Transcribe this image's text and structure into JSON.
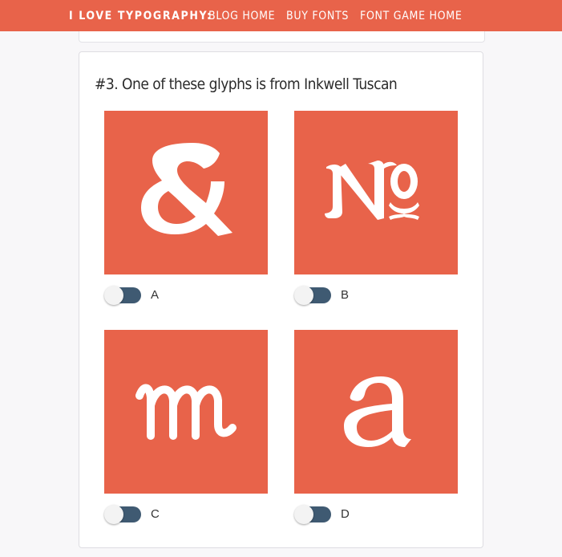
{
  "nav": {
    "brand": "I LOVE TYPOGRAPHY:",
    "links": [
      "BLOG HOME",
      "BUY FONTS",
      "FONT GAME HOME"
    ]
  },
  "question": {
    "text": "#3. One of these glyphs is from Inkwell Tuscan"
  },
  "options": [
    {
      "label": "A",
      "glyph": "ampersand-glyph-icon",
      "selected": false
    },
    {
      "label": "B",
      "glyph": "numero-sign-glyph-icon",
      "selected": false
    },
    {
      "label": "C",
      "glyph": "script-m-glyph-icon",
      "selected": false
    },
    {
      "label": "D",
      "glyph": "lowercase-a-glyph-icon",
      "selected": false
    }
  ],
  "colors": {
    "accent": "#e8634a",
    "toggle_track": "#3f5a72",
    "toggle_knob": "#f3f3f3",
    "glyph": "#ffffff"
  }
}
